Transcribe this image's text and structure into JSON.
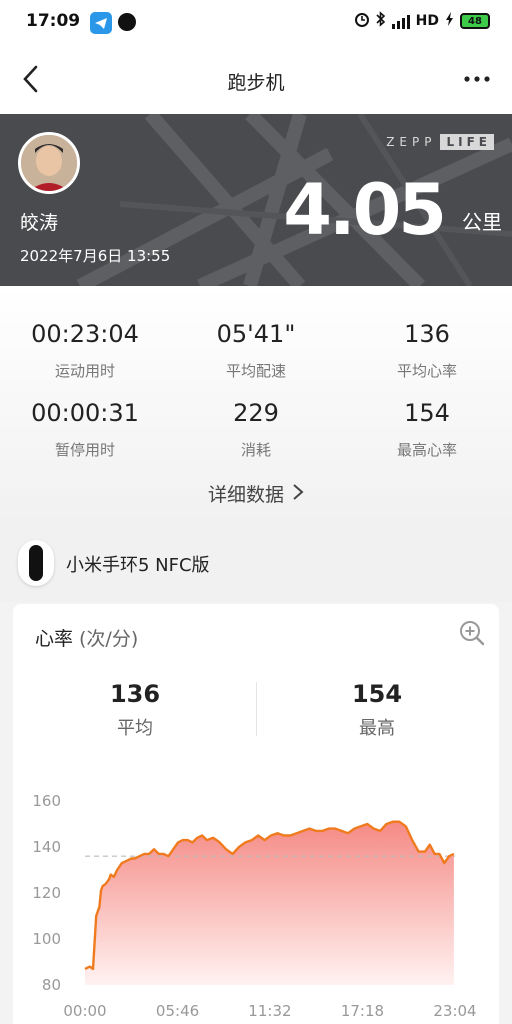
{
  "status_bar": {
    "time": "17:09",
    "network": "HD",
    "battery": "48",
    "icons": [
      "telegram-icon",
      "chat-icon",
      "alarm-icon",
      "bluetooth-icon",
      "signal-icon",
      "charging-icon",
      "battery-icon"
    ]
  },
  "nav": {
    "title": "跑步机"
  },
  "header": {
    "user_name": "皎涛",
    "datetime": "2022年7月6日 13:55",
    "brand_left": "ZEPP",
    "brand_right": "LIFE",
    "distance": "4.05",
    "unit": "公里"
  },
  "stats": [
    {
      "value": "00:23:04",
      "label": "运动用时"
    },
    {
      "value": "05'41\"",
      "label": "平均配速"
    },
    {
      "value": "136",
      "label": "平均心率"
    },
    {
      "value": "00:00:31",
      "label": "暂停用时"
    },
    {
      "value": "229",
      "label": "消耗"
    },
    {
      "value": "154",
      "label": "最高心率"
    }
  ],
  "detail_link": "详细数据",
  "device": {
    "name": "小米手环5 NFC版"
  },
  "heart_rate": {
    "title": "心率",
    "unit": "(次/分)",
    "average_value": "136",
    "average_label": "平均",
    "max_value": "154",
    "max_label": "最高"
  },
  "chart_data": {
    "type": "area",
    "x_tick_labels": [
      "00:00",
      "05:46",
      "11:32",
      "17:18",
      "23:04"
    ],
    "x_ticks_minutes": [
      0,
      5.77,
      11.53,
      17.3,
      23.07
    ],
    "xlim": [
      0,
      23.07
    ],
    "ylim": [
      80,
      160
    ],
    "y_ticks": [
      80,
      100,
      120,
      140,
      160
    ],
    "reference_line": 136,
    "line_color": "#f07b1e",
    "fill_color_top": "#f58a85",
    "fill_color_bottom": "#fff2f1",
    "series": [
      {
        "x": [
          0,
          0.3,
          0.5,
          0.7,
          0.9,
          1.0,
          1.1,
          1.3,
          1.5,
          1.6,
          1.8,
          2.0,
          2.3,
          2.6,
          2.9,
          3.1,
          3.4,
          3.7,
          4.0,
          4.3,
          4.6,
          4.9,
          5.2,
          5.5,
          5.8,
          6.1,
          6.4,
          6.7,
          7.0,
          7.3,
          7.6,
          8.0,
          8.4,
          8.8,
          9.2,
          9.6,
          10.0,
          10.4,
          10.8,
          11.2,
          11.6,
          12.0,
          12.4,
          12.8,
          13.2,
          13.6,
          14.0,
          14.4,
          14.8,
          15.2,
          15.6,
          16.0,
          16.4,
          16.8,
          17.2,
          17.6,
          18.0,
          18.4,
          18.8,
          19.2,
          19.6,
          20.0,
          20.4,
          20.8,
          21.2,
          21.5,
          21.8,
          22.1,
          22.4,
          22.7,
          23.0
        ],
        "y": [
          87,
          88,
          87,
          110,
          114,
          121,
          123,
          124,
          126,
          128,
          127,
          130,
          133,
          134,
          135,
          135,
          136,
          137,
          137,
          139,
          137,
          137,
          136,
          139,
          142,
          143,
          143,
          142,
          144,
          145,
          143,
          144,
          142,
          139,
          137,
          140,
          142,
          143,
          145,
          143,
          145,
          146,
          145,
          145,
          146,
          147,
          148,
          147,
          147,
          148,
          148,
          147,
          146,
          148,
          149,
          150,
          148,
          147,
          150,
          151,
          151,
          149,
          143,
          138,
          138,
          141,
          137,
          137,
          133,
          136,
          137
        ]
      }
    ]
  }
}
